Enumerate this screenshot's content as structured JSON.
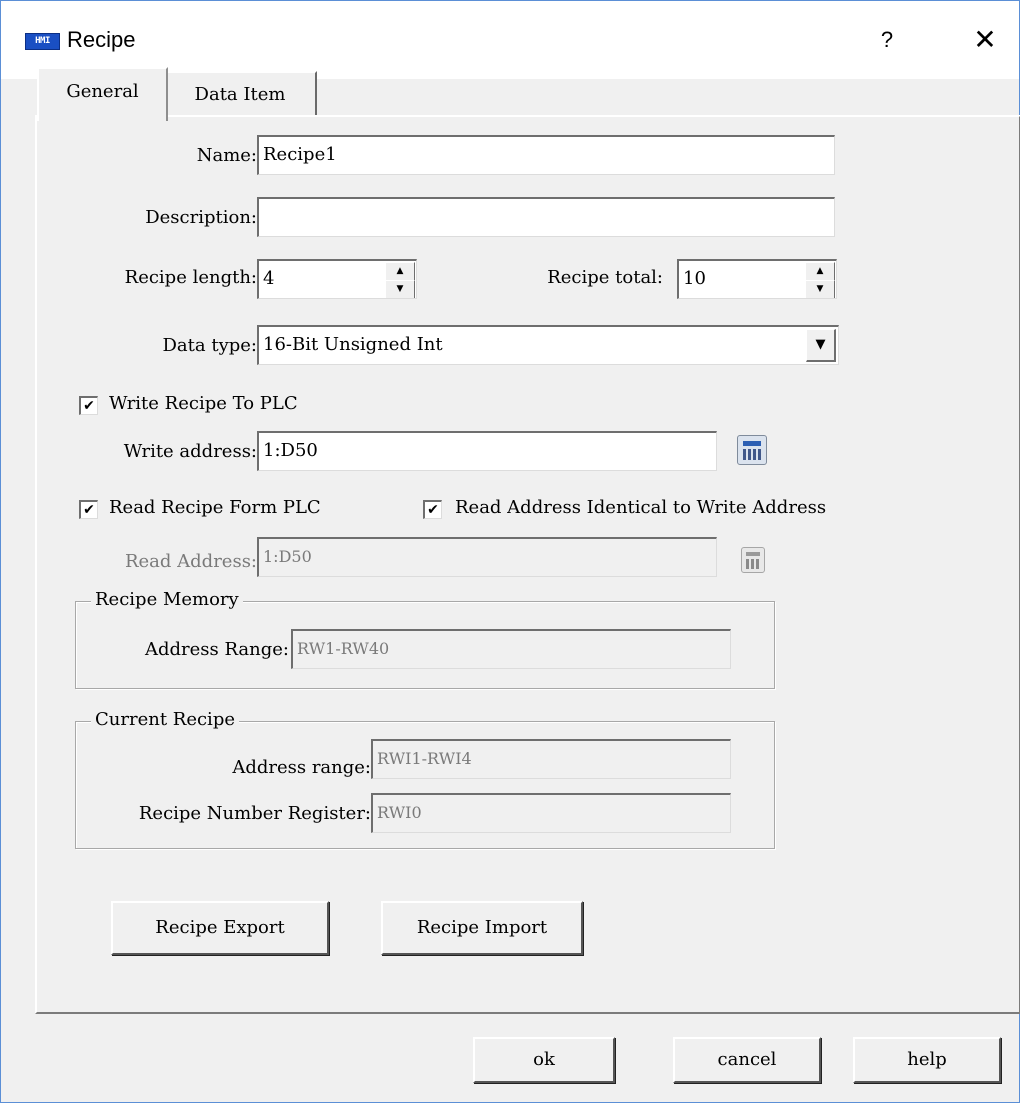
{
  "window": {
    "title": "Recipe",
    "icon_text": "HMI",
    "help_glyph": "?",
    "close_glyph": "✕"
  },
  "tabs": [
    {
      "label": "General",
      "active": true
    },
    {
      "label": "Data Item",
      "active": false
    }
  ],
  "general": {
    "name_label": "Name:",
    "name_value": "Recipe1",
    "description_label": "Description:",
    "description_value": "",
    "recipe_length_label": "Recipe length:",
    "recipe_length_value": "4",
    "recipe_total_label": "Recipe total:",
    "recipe_total_value": "10",
    "data_type_label": "Data type:",
    "data_type_value": "16-Bit Unsigned Int",
    "write_to_plc_label": "Write Recipe To PLC",
    "write_to_plc_checked": true,
    "write_address_label": "Write address:",
    "write_address_value": "1:D50",
    "read_from_plc_label": "Read Recipe Form PLC",
    "read_from_plc_checked": true,
    "read_identical_label": "Read Address Identical to Write Address",
    "read_identical_checked": true,
    "read_address_label": "Read Address:",
    "read_address_value": "1:D50"
  },
  "recipe_memory": {
    "title": "Recipe Memory",
    "address_range_label": "Address Range:",
    "address_range_value": "RW1-RW40"
  },
  "current_recipe": {
    "title": "Current Recipe",
    "address_range_label": "Address range:",
    "address_range_value": "RWI1-RWI4",
    "number_register_label": "Recipe Number Register:",
    "number_register_value": "RWI0"
  },
  "actions": {
    "export_label": "Recipe Export",
    "import_label": "Recipe Import"
  },
  "footer": {
    "ok_label": "ok",
    "cancel_label": "cancel",
    "help_label": "help"
  },
  "glyphs": {
    "check": "✔",
    "spin_up": "▲",
    "spin_down": "▼",
    "dropdown": "▼"
  },
  "icons": [
    "hmi-app-icon",
    "help-icon",
    "close-icon",
    "calculator-icon",
    "calculator-icon-disabled"
  ]
}
